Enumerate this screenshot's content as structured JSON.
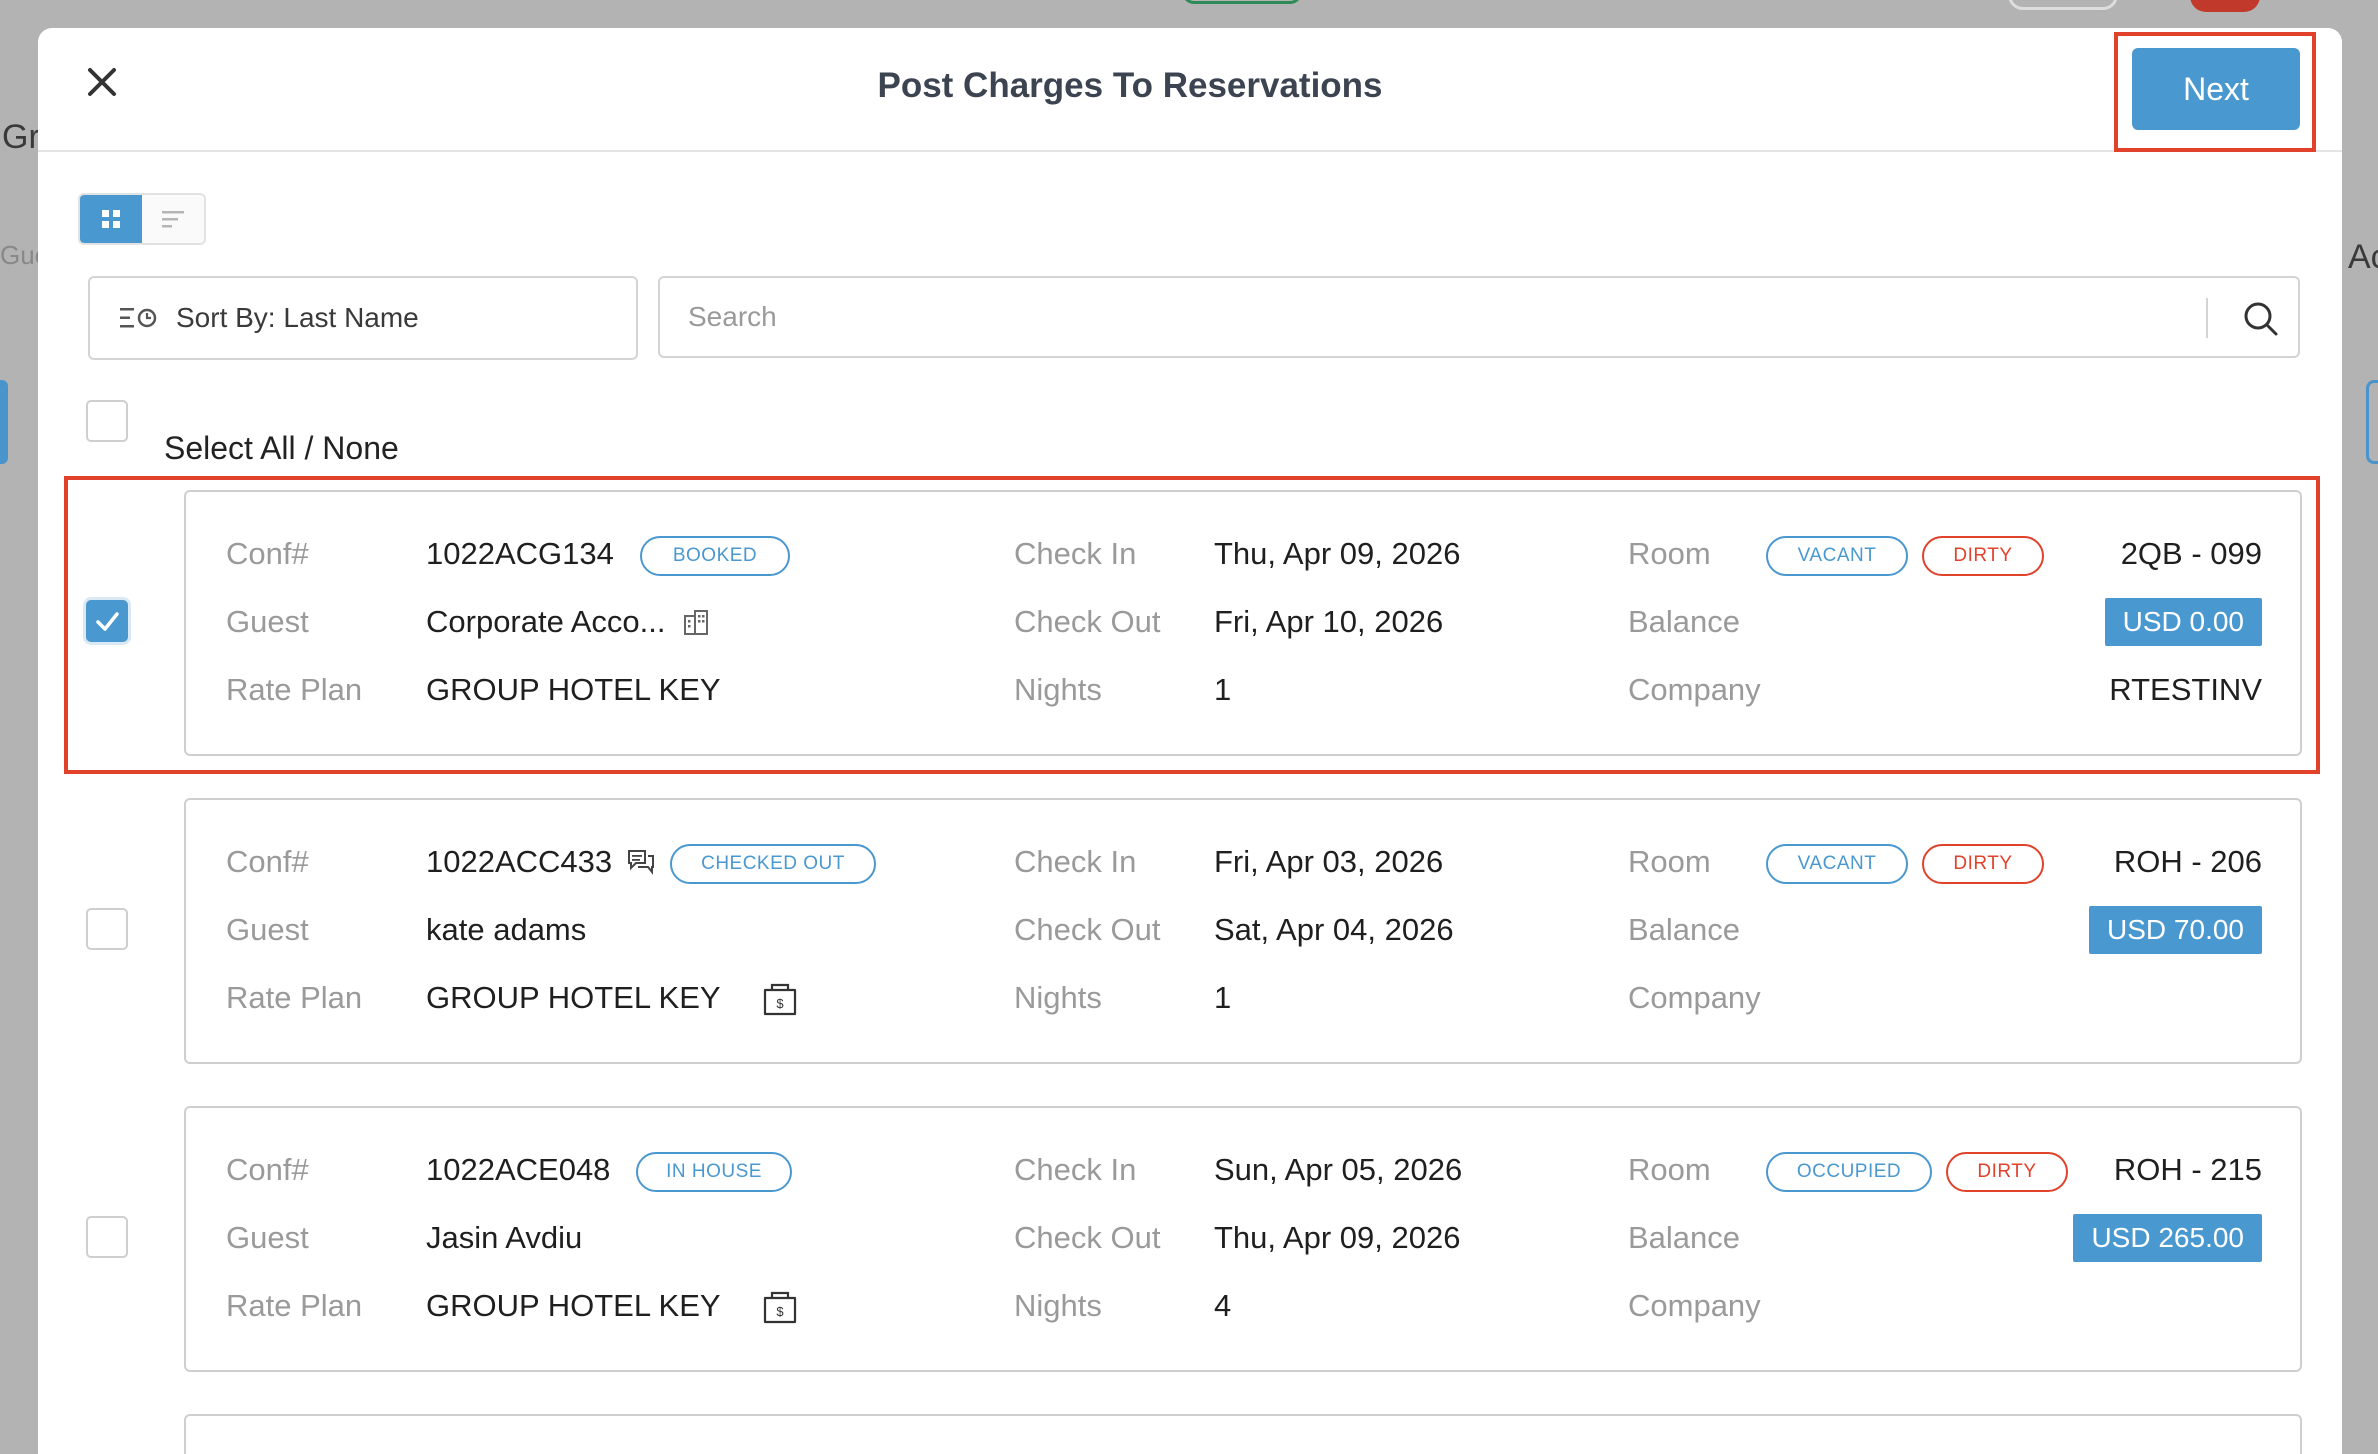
{
  "modal": {
    "title": "Post Charges To Reservations",
    "next_label": "Next"
  },
  "toolbar": {
    "sort_label": "Sort By: Last Name",
    "search_placeholder": "Search",
    "select_all_label": "Select All / None"
  },
  "labels": {
    "conf": "Conf#",
    "guest": "Guest",
    "rate_plan": "Rate Plan",
    "check_in": "Check In",
    "check_out": "Check Out",
    "nights": "Nights",
    "room": "Room",
    "balance": "Balance",
    "company": "Company"
  },
  "reservations": [
    {
      "selected": true,
      "conf": "1022ACG134",
      "status": "BOOKED",
      "guest": "Corporate Acco...",
      "rate_plan": "GROUP HOTEL KEY",
      "check_in": "Thu, Apr 09, 2026",
      "check_out": "Fri, Apr 10, 2026",
      "nights": "1",
      "room_status": "VACANT",
      "housekeeping": "DIRTY",
      "room": "2QB - 099",
      "balance": "USD 0.00",
      "company": "RTESTINV"
    },
    {
      "selected": false,
      "conf": "1022ACC433",
      "status": "CHECKED OUT",
      "guest": "kate adams",
      "rate_plan": "GROUP HOTEL KEY",
      "check_in": "Fri, Apr 03, 2026",
      "check_out": "Sat, Apr 04, 2026",
      "nights": "1",
      "room_status": "VACANT",
      "housekeeping": "DIRTY",
      "room": "ROH - 206",
      "balance": "USD 70.00",
      "company": ""
    },
    {
      "selected": false,
      "conf": "1022ACE048",
      "status": "IN HOUSE",
      "guest": "Jasin Avdiu",
      "rate_plan": "GROUP HOTEL KEY",
      "check_in": "Sun, Apr 05, 2026",
      "check_out": "Thu, Apr 09, 2026",
      "nights": "4",
      "room_status": "OCCUPIED",
      "housekeeping": "DIRTY",
      "room": "ROH - 215",
      "balance": "USD 265.00",
      "company": ""
    }
  ],
  "background": {
    "frag_left": "Gr",
    "frag_left2": "Gue",
    "frag_right": "Ac"
  },
  "colors": {
    "accent": "#4a98d0",
    "highlight": "#e0422b"
  }
}
